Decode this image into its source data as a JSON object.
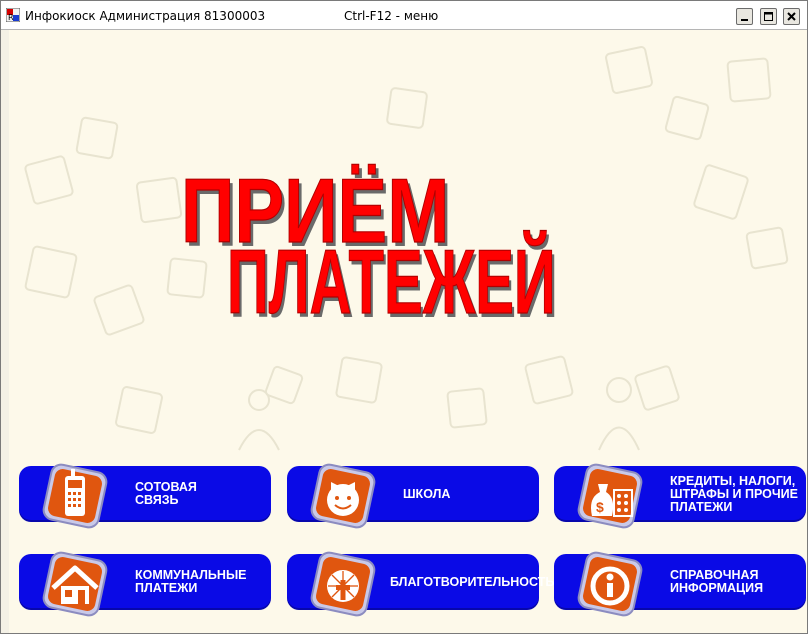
{
  "window": {
    "title": "Инфокиоск Администрация 81300003",
    "hint": "Ctrl-F12 - меню"
  },
  "headline": {
    "line1": "ПРИЁМ",
    "line2": "ПЛАТЕЖЕЙ",
    "color": "#ff0000"
  },
  "tiles": [
    {
      "label": "СОТОВАЯ\nСВЯЗЬ",
      "icon": "mobile-phone-icon"
    },
    {
      "label": "ШКОЛА",
      "icon": "child-face-icon"
    },
    {
      "label": "КРЕДИТЫ, НАЛОГИ,\nШТРАФЫ И ПРОЧИЕ\nПЛАТЕЖИ",
      "icon": "money-bag-abacus-icon"
    },
    {
      "label": "КОММУНАЛЬНЫЕ\nПЛАТЕЖИ",
      "icon": "house-icon"
    },
    {
      "label": "БЛАГОТВОРИТЕЛЬНОСТЬ",
      "icon": "charity-cross-icon"
    },
    {
      "label": "СПРАВОЧНАЯ\nИНФОРМАЦИЯ",
      "icon": "info-icon"
    }
  ],
  "colors": {
    "tile": "#0a0ae6",
    "icon_orange": "#e0560f",
    "background": "#fdf9ea"
  }
}
